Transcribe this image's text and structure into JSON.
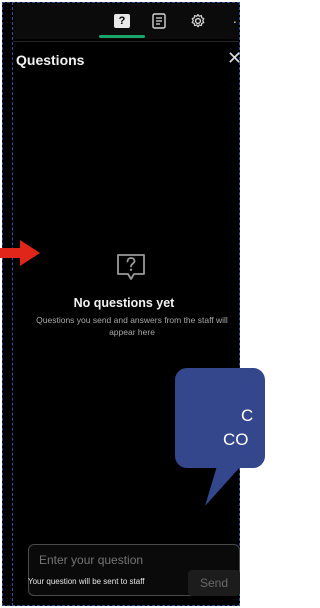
{
  "toolbar": {
    "questions_tab_icon": "question-box-icon",
    "questions_tab_glyph": "?",
    "notes_tab_icon": "notes-icon",
    "settings_icon": "gear-icon",
    "more_icon": "more-horizontal-icon",
    "more_glyph": "···",
    "active_color": "#1aa36b"
  },
  "panel": {
    "title": "Questions",
    "close_glyph": "✕"
  },
  "empty_state": {
    "icon": "question-bubble-icon",
    "title": "No questions yet",
    "subtitle": "Questions you send and answers from the staff will appear here"
  },
  "callout": {
    "line1": "",
    "line2": "C",
    "line3": "CO",
    "color": "#34468c"
  },
  "composer": {
    "placeholder": "Enter your question",
    "hint": "Your question will be sent to staff",
    "send_label": "Send"
  }
}
